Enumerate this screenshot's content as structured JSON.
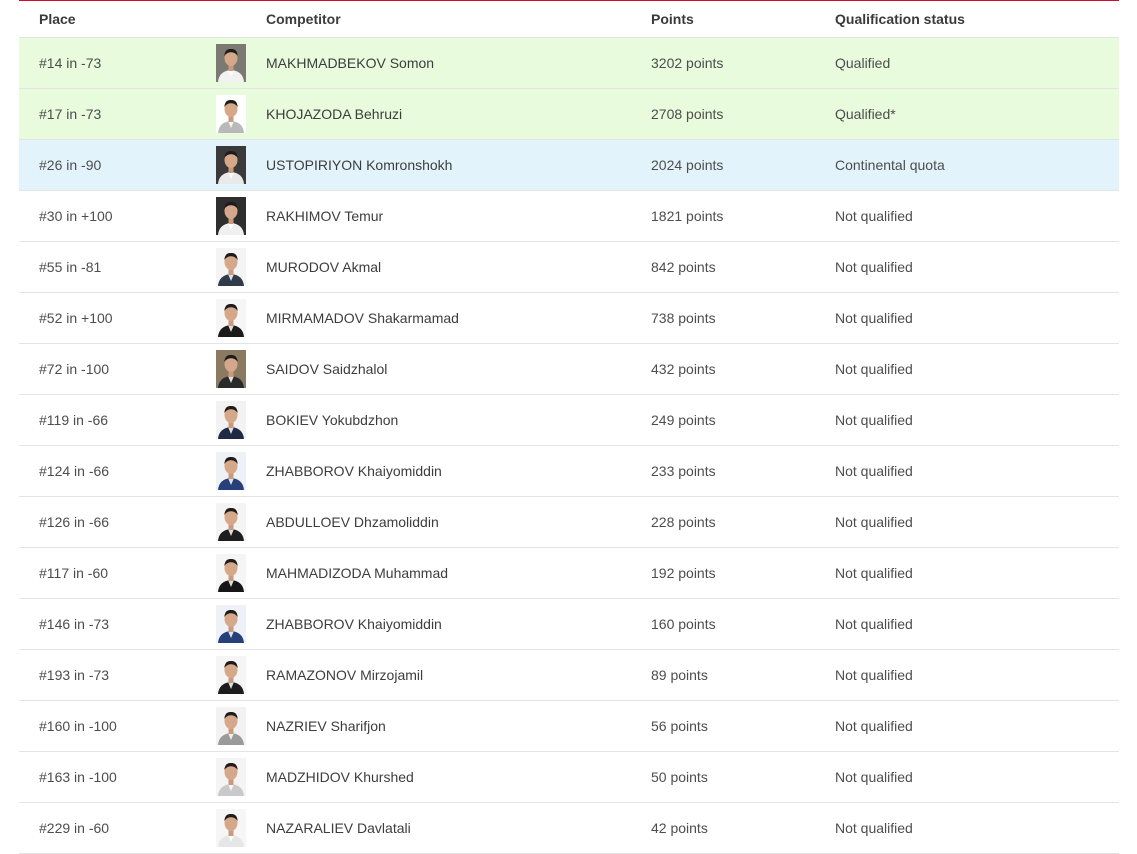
{
  "table": {
    "headers": {
      "place": "Place",
      "competitor": "Competitor",
      "points": "Points",
      "status": "Qualification status"
    },
    "rows": [
      {
        "place": "#14 in -73",
        "name": "MAKHMADBEKOV Somon",
        "points": "3202 points",
        "status": "Qualified",
        "highlight": "qualified",
        "bg": "#7a7a72",
        "jacket": "#f2f2f2"
      },
      {
        "place": "#17 in -73",
        "name": "KHOJAZODA Behruzi",
        "points": "2708 points",
        "status": "Qualified*",
        "highlight": "qualified",
        "bg": "#ffffff",
        "jacket": "#b9b9b9"
      },
      {
        "place": "#26 in -90",
        "name": "USTOPIRIYON Komronshokh",
        "points": "2024 points",
        "status": "Continental quota",
        "highlight": "continental",
        "bg": "#3a3a3a",
        "jacket": "#e9e9e9"
      },
      {
        "place": "#30 in +100",
        "name": "RAKHIMOV Temur",
        "points": "1821 points",
        "status": "Not qualified",
        "highlight": "",
        "bg": "#2e2e2e",
        "jacket": "#f0f0f0"
      },
      {
        "place": "#55 in -81",
        "name": "MURODOV Akmal",
        "points": "842 points",
        "status": "Not qualified",
        "highlight": "",
        "bg": "#f4f4f4",
        "jacket": "#2f3a4a"
      },
      {
        "place": "#52 in +100",
        "name": "MIRMAMADOV Shakarmamad",
        "points": "738 points",
        "status": "Not qualified",
        "highlight": "",
        "bg": "#f6f6f6",
        "jacket": "#1b1b1b"
      },
      {
        "place": "#72 in -100",
        "name": "SAIDOV Saidzhalol",
        "points": "432 points",
        "status": "Not qualified",
        "highlight": "",
        "bg": "#8a7a62",
        "jacket": "#2a2a2a"
      },
      {
        "place": "#119 in -66",
        "name": "BOKIEV Yokubdzhon",
        "points": "249 points",
        "status": "Not qualified",
        "highlight": "",
        "bg": "#f2f2f2",
        "jacket": "#1f2a44"
      },
      {
        "place": "#124 in -66",
        "name": "ZHABBOROV Khaiyomiddin",
        "points": "233 points",
        "status": "Not qualified",
        "highlight": "",
        "bg": "#eef1f6",
        "jacket": "#27407a"
      },
      {
        "place": "#126 in -66",
        "name": "ABDULLOEV Dhzamoliddin",
        "points": "228 points",
        "status": "Not qualified",
        "highlight": "",
        "bg": "#f4f4f4",
        "jacket": "#1e1e1e"
      },
      {
        "place": "#117 in -60",
        "name": "MAHMADIZODA Muhammad",
        "points": "192 points",
        "status": "Not qualified",
        "highlight": "",
        "bg": "#f5f5f5",
        "jacket": "#161616"
      },
      {
        "place": "#146 in -73",
        "name": "ZHABBOROV Khaiyomiddin",
        "points": "160 points",
        "status": "Not qualified",
        "highlight": "",
        "bg": "#eef1f6",
        "jacket": "#27407a"
      },
      {
        "place": "#193 in -73",
        "name": "RAMAZONOV Mirzojamil",
        "points": "89 points",
        "status": "Not qualified",
        "highlight": "",
        "bg": "#f5f5f5",
        "jacket": "#1d1d1d"
      },
      {
        "place": "#160 in -100",
        "name": "NAZRIEV Sharifjon",
        "points": "56 points",
        "status": "Not qualified",
        "highlight": "",
        "bg": "#f2f2f2",
        "jacket": "#9a9a9a"
      },
      {
        "place": "#163 in -100",
        "name": "MADZHIDOV Khurshed",
        "points": "50 points",
        "status": "Not qualified",
        "highlight": "",
        "bg": "#f4f4f4",
        "jacket": "#c9c9c9"
      },
      {
        "place": "#229 in -60",
        "name": "NAZARALIEV Davlatali",
        "points": "42 points",
        "status": "Not qualified",
        "highlight": "",
        "bg": "#f6f6f6",
        "jacket": "#e6e6e6"
      }
    ]
  },
  "colors": {
    "accent_rule": "#c8102e",
    "qualified_bg": "#e8fbdc",
    "continental_bg": "#e3f3fb"
  }
}
